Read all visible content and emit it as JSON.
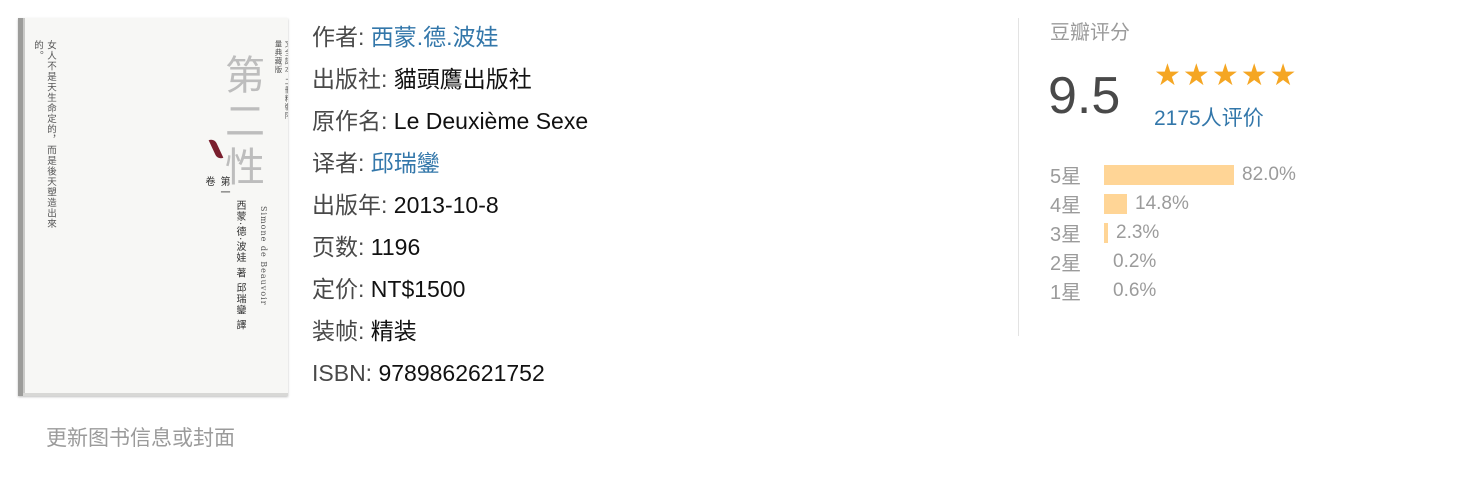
{
  "cover": {
    "quote": "女人不是天生命定的，而是後天塑造出來的。",
    "desc": "唯一法文直譯經典中文全譯本·二冊精裝限量典藏版",
    "title": "第二性",
    "volume": "第一卷",
    "author": "西蒙·德·波娃 著 邱瑞鑾 譯",
    "author_en": "Simone de Beauvoir"
  },
  "update_link": "更新图书信息或封面",
  "info": {
    "author_label": "作者: ",
    "author": "西蒙.德.波娃",
    "publisher_label": "出版社: ",
    "publisher": "貓頭鷹出版社",
    "original_title_label": "原作名: ",
    "original_title": "Le Deuxième Sexe",
    "translator_label": "译者: ",
    "translator": "邱瑞鑾",
    "pub_year_label": "出版年: ",
    "pub_year": "2013-10-8",
    "pages_label": "页数: ",
    "pages": "1196",
    "price_label": "定价: ",
    "price": "NT$1500",
    "binding_label": "装帧: ",
    "binding": "精装",
    "isbn_label": "ISBN: ",
    "isbn": "9789862621752"
  },
  "rating": {
    "title": "豆瓣评分",
    "score": "9.5",
    "stars": 5,
    "votes": "2175人评价",
    "accent": "#f5a623",
    "bar_color": "#ffd596",
    "distribution": [
      {
        "label": "5星",
        "percent": 82.0,
        "text": "82.0%"
      },
      {
        "label": "4星",
        "percent": 14.8,
        "text": "14.8%"
      },
      {
        "label": "3星",
        "percent": 2.3,
        "text": "2.3%"
      },
      {
        "label": "2星",
        "percent": 0.2,
        "text": "0.2%"
      },
      {
        "label": "1星",
        "percent": 0.6,
        "text": "0.6%"
      }
    ]
  }
}
